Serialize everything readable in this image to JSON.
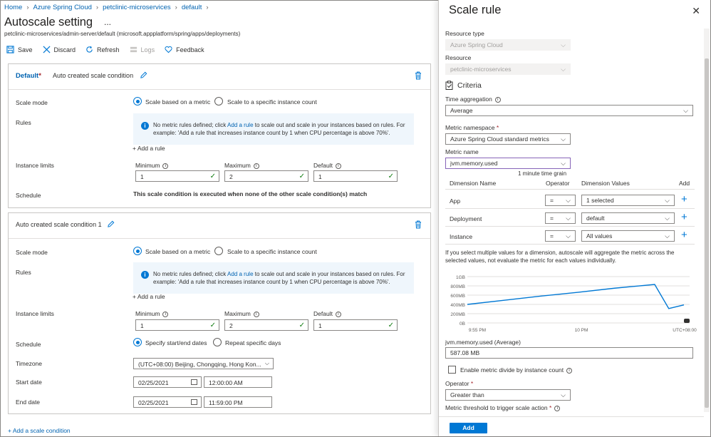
{
  "breadcrumb": [
    "Home",
    "Azure Spring Cloud",
    "petclinic-microservices",
    "default"
  ],
  "page": {
    "title": "Autoscale setting",
    "more": "...",
    "subpath": "petclinic-microservices/admin-server/default (microsoft.appplatform/spring/apps/deployments)"
  },
  "toolbar": {
    "save": "Save",
    "discard": "Discard",
    "refresh": "Refresh",
    "logs": "Logs",
    "feedback": "Feedback"
  },
  "card1": {
    "default_label": "Default",
    "star": "*",
    "condition_name": "Auto created scale condition",
    "scale_mode_label": "Scale mode",
    "opt_metric": "Scale based on a metric",
    "opt_count": "Scale to a specific instance count",
    "rules_label": "Rules",
    "info_pre": "No metric rules defined; click ",
    "info_link": "Add a rule",
    "info_post": " to scale out and scale in your instances based on rules. For example: 'Add a rule that increases instance count by 1 when CPU percentage is above 70%'.",
    "add_rule": "+ Add a rule",
    "limits_label": "Instance limits",
    "min_label": "Minimum",
    "max_label": "Maximum",
    "def_label": "Default",
    "min": "1",
    "max": "2",
    "def": "1",
    "schedule_label": "Schedule",
    "schedule_text": "This scale condition is executed when none of the other scale condition(s) match"
  },
  "card2": {
    "condition_name": "Auto created scale condition 1",
    "scale_mode_label": "Scale mode",
    "opt_metric": "Scale based on a metric",
    "opt_count": "Scale to a specific instance count",
    "rules_label": "Rules",
    "info_pre": "No metric rules defined; click ",
    "info_link": "Add a rule",
    "info_post": " to scale out and scale in your instances based on rules. For example: 'Add a rule that increases instance count by 1 when CPU percentage is above 70%'.",
    "add_rule": "+ Add a rule",
    "limits_label": "Instance limits",
    "min_label": "Minimum",
    "max_label": "Maximum",
    "def_label": "Default",
    "min": "1",
    "max": "2",
    "def": "1",
    "schedule_label": "Schedule",
    "opt_dates": "Specify start/end dates",
    "opt_repeat": "Repeat specific days",
    "timezone_label": "Timezone",
    "timezone": "(UTC+08:00) Beijing, Chongqing, Hong Kon...",
    "start_label": "Start date",
    "start_date": "02/25/2021",
    "start_time": "12:00:00 AM",
    "end_label": "End date",
    "end_date": "02/25/2021",
    "end_time": "11:59:00 PM"
  },
  "add_condition": "+ Add a scale condition",
  "panel": {
    "title": "Scale rule",
    "close": "✕",
    "resource_type_label": "Resource type",
    "resource_type": "Azure Spring Cloud",
    "resource_label": "Resource",
    "resource": "petclinic-microservices",
    "criteria": "Criteria",
    "time_agg_label": "Time aggregation",
    "time_agg": "Average",
    "namespace_label": "Metric namespace",
    "namespace": "Azure Spring Cloud standard metrics",
    "metric_name_label": "Metric name",
    "metric_name": "jvm.memory.used",
    "grain": "1 minute time grain",
    "dim_headers": {
      "name": "Dimension Name",
      "op": "Operator",
      "values": "Dimension Values",
      "add": "Add"
    },
    "dims": [
      {
        "name": "App",
        "op": "=",
        "value": "1 selected"
      },
      {
        "name": "Deployment",
        "op": "=",
        "value": "default"
      },
      {
        "name": "Instance",
        "op": "=",
        "value": "All values"
      }
    ],
    "dim_note": "If you select multiple values for a dimension, autoscale will aggregate the metric across the selected values, not evaluate the metric for each values individually.",
    "metric_summary_label": "jvm.memory.used (Average)",
    "metric_summary": "587.08 MB",
    "divide_label": "Enable metric divide by instance count",
    "operator_label": "Operator",
    "operator": "Greater than",
    "threshold_label": "Metric threshold to trigger scale action",
    "add_button": "Add"
  },
  "chart_data": {
    "type": "line",
    "y_ticks": [
      "1GB",
      "800MB",
      "600MB",
      "400MB",
      "200MB",
      "0B"
    ],
    "x_ticks": [
      "9:55 PM",
      "10 PM",
      "UTC+08:00"
    ],
    "ylim": [
      0,
      1000
    ],
    "unit": "MB",
    "series": [
      {
        "values": [
          400,
          490,
          580,
          660,
          750,
          830,
          310,
          390
        ]
      }
    ],
    "color": "#0078d4"
  }
}
